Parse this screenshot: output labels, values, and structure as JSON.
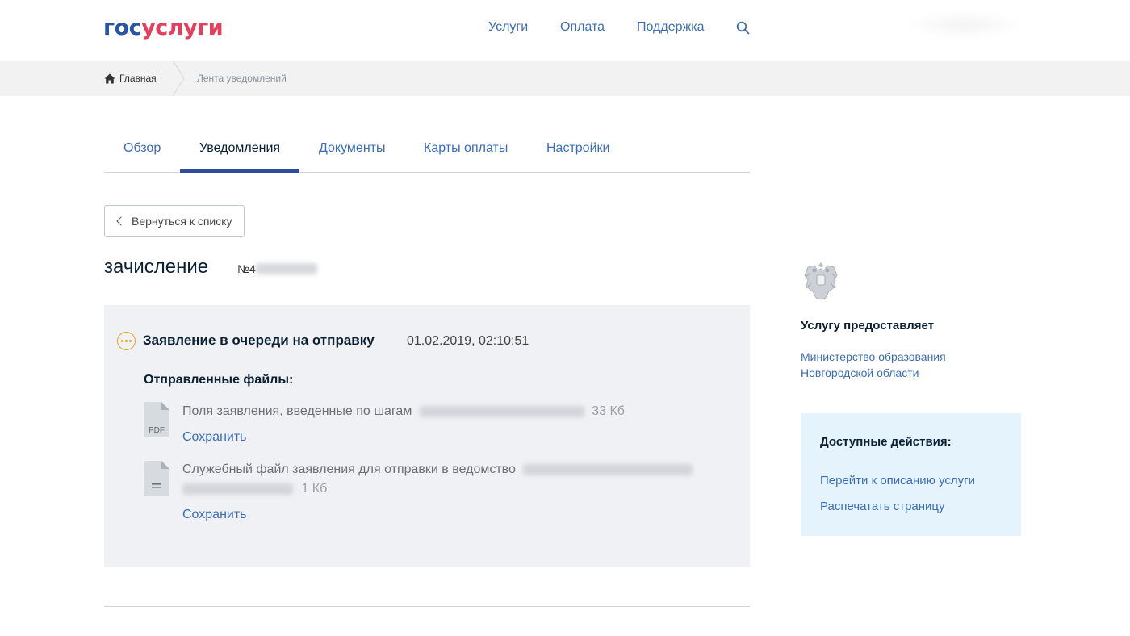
{
  "header": {
    "logo_part1": "гос",
    "logo_part2": "услуги",
    "nav": [
      "Услуги",
      "Оплата",
      "Поддержка"
    ],
    "search_icon": "search-icon"
  },
  "breadcrumb": {
    "home_icon": "home-icon",
    "home_label": "Главная",
    "current": "Лента уведомлений"
  },
  "tabs": [
    "Обзор",
    "Уведомления",
    "Документы",
    "Карты оплаты",
    "Настройки"
  ],
  "active_tab": "Уведомления",
  "back_button": "Вернуться к списку",
  "notification": {
    "title": "зачисление",
    "number_prefix": "№4",
    "status_icon": "pending-dots-icon",
    "status": "Заявление в очереди на отправку",
    "datetime": "01.02.2019, 02:10:51",
    "files_heading": "Отправленные файлы:",
    "files": [
      {
        "icon": "pdf-file-icon",
        "icon_label": "PDF",
        "description": "Поля заявления, введенные по шагам",
        "size": "33 Кб",
        "save_label": "Сохранить"
      },
      {
        "icon": "text-file-icon",
        "description": "Служебный файл заявления для отправки в ведомство",
        "size": "1 Кб",
        "save_label": "Сохранить"
      }
    ]
  },
  "provider": {
    "emblem_icon": "coat-of-arms-icon",
    "title": "Услугу предоставляет",
    "name_line1": "Министерство образования",
    "name_line2": "Новгородской области"
  },
  "actions": {
    "title": "Доступные действия:",
    "items": [
      "Перейти к описанию услуги",
      "Распечатать страницу"
    ]
  },
  "colors": {
    "logo_blue": "#2a55a2",
    "logo_red": "#e2405e",
    "link_blue": "#3b6db4",
    "tab_underline": "#2c4e9a",
    "status_orange": "#e8a21f",
    "panel_bg": "#f0f1f4",
    "actions_bg": "#e4f3fc"
  }
}
